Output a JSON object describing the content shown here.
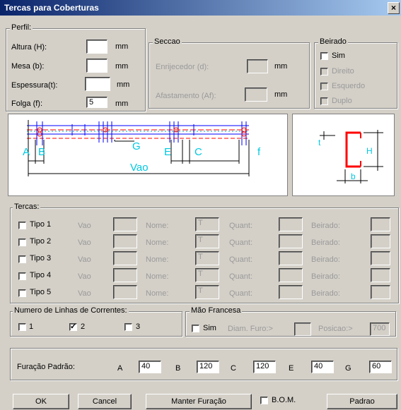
{
  "window": {
    "title": "Tercas para Coberturas",
    "close": "×"
  },
  "perfil": {
    "legend": "Perfil:",
    "rows": [
      {
        "label": "Altura (H):",
        "value": "",
        "unit": "mm"
      },
      {
        "label": "Mesa (b):",
        "value": "",
        "unit": "mm"
      },
      {
        "label": "Espessura(t):",
        "value": "",
        "unit": "mm"
      },
      {
        "label": "Folga (f):",
        "value": "5",
        "unit": "mm"
      }
    ]
  },
  "seccao": {
    "legend": "Seccao",
    "enrijecedor_label": "Enrijecedor (d):",
    "enrijecedor_unit": "mm",
    "afastamento_label": "Afastamento (Af):",
    "afastamento_unit": "mm"
  },
  "beirado": {
    "legend": "Beirado",
    "options": [
      "Sim",
      "Direito",
      "Esquerdo",
      "Duplo"
    ]
  },
  "diagram": {
    "labels": {
      "A": "A",
      "B": "B",
      "G": "G",
      "E": "E",
      "C": "C",
      "f": "f",
      "Vao": "Vao"
    }
  },
  "section_diagram": {
    "labels": {
      "t": "t",
      "H": "H",
      "b": "b"
    }
  },
  "tercas": {
    "legend": "Tercas:",
    "rows": [
      {
        "label": "Tipo 1",
        "vao": "Vao",
        "nome": "Nome:",
        "nome_value": "T",
        "quant": "Quant:",
        "beirado": "Beirado:"
      },
      {
        "label": "Tipo 2",
        "vao": "Vao",
        "nome": "Nome:",
        "nome_value": "T",
        "quant": "Quant:",
        "beirado": "Beirado:"
      },
      {
        "label": "Tipo 3",
        "vao": "Vao",
        "nome": "Nome:",
        "nome_value": "T",
        "quant": "Quant:",
        "beirado": "Beirado:"
      },
      {
        "label": "Tipo 4",
        "vao": "Vao",
        "nome": "Nome:",
        "nome_value": "T",
        "quant": "Quant:",
        "beirado": "Beirado:"
      },
      {
        "label": "Tipo 5",
        "vao": "Vao",
        "nome": "Nome:",
        "nome_value": "T",
        "quant": "Quant:",
        "beirado": "Beirado:"
      }
    ]
  },
  "correntes": {
    "legend": "Numero de Linhas de Correntes:",
    "options": [
      {
        "label": "1",
        "checked": false
      },
      {
        "label": "2",
        "checked": true
      },
      {
        "label": "3",
        "checked": false
      }
    ]
  },
  "mao": {
    "legend": "Mão Francesa",
    "sim": "Sim",
    "diam_label": "Diam. Furo:>",
    "diam_value": "",
    "posicao_label": "Posicao:>",
    "posicao_value": "700"
  },
  "furacao": {
    "label": "Furação Padrão:",
    "fields": [
      {
        "label": "A",
        "value": "40"
      },
      {
        "label": "B",
        "value": "120"
      },
      {
        "label": "C",
        "value": "120"
      },
      {
        "label": "E",
        "value": "40"
      },
      {
        "label": "G",
        "value": "60"
      }
    ]
  },
  "buttons": {
    "ok": "OK",
    "cancel": "Cancel",
    "manter": "Manter Furação",
    "bom": "B.O.M.",
    "padrao": "Padrao"
  },
  "check_mark": "✓"
}
